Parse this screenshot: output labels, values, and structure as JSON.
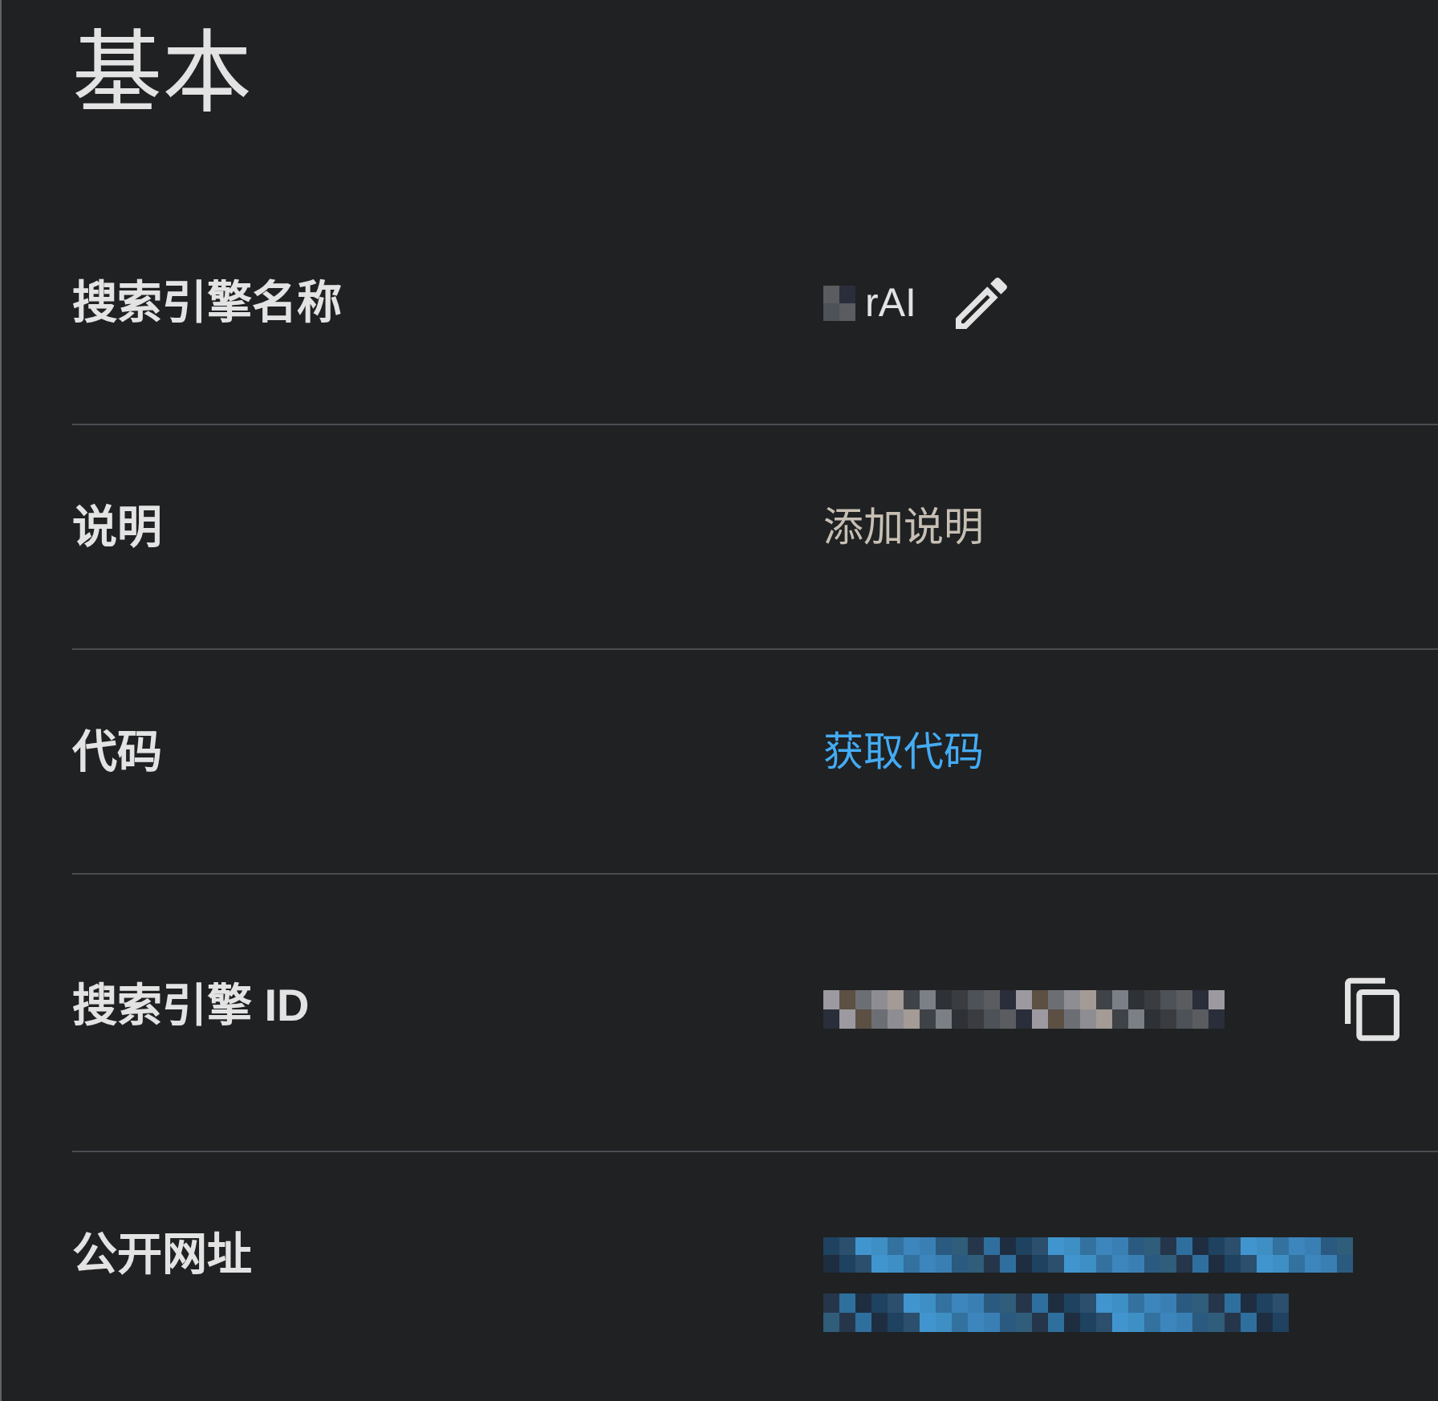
{
  "section": {
    "title": "基本"
  },
  "rows": [
    {
      "label": "搜索引擎名称",
      "kind": "editable",
      "value": "rAI",
      "redacted": true
    },
    {
      "label": "说明",
      "kind": "hint",
      "value": "添加说明",
      "redacted": false
    },
    {
      "label": "代码",
      "kind": "link",
      "value": "获取代码",
      "redacted": false
    },
    {
      "label": "搜索引擎 ID",
      "kind": "copyable",
      "redacted": true
    },
    {
      "label": "公开网址",
      "kind": "link",
      "redacted": true
    }
  ]
}
